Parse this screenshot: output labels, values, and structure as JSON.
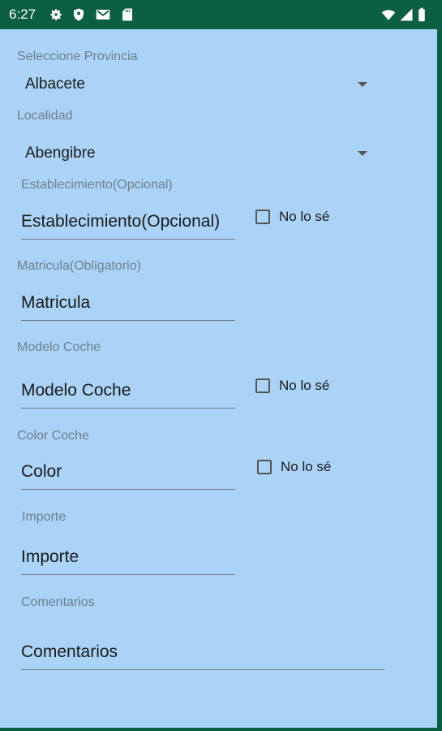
{
  "status_bar": {
    "time": "6:27",
    "left_icons": [
      "gear-icon",
      "shield-icon",
      "gmail-icon",
      "sd-card-icon"
    ],
    "right_icons": [
      "wifi-icon",
      "signal-icon",
      "battery-icon"
    ]
  },
  "colors": {
    "status_bar": "#0d5f44",
    "background": "#aad3f7"
  },
  "form": {
    "provincia": {
      "label": "Seleccione Provincia",
      "value": "Albacete"
    },
    "localidad": {
      "label": "Localidad",
      "value": "Abengibre"
    },
    "establecimiento": {
      "label": "Establecimiento(Opcional)",
      "placeholder": "Establecimiento(Opcional)",
      "checkbox_label": "No lo sé"
    },
    "matricula": {
      "label": "Matricula(Obligatorio)",
      "placeholder": "Matricula"
    },
    "modelo": {
      "label": "Modelo Coche",
      "placeholder": "Modelo Coche",
      "checkbox_label": "No lo sé"
    },
    "color": {
      "label": "Color Coche",
      "placeholder": "Color",
      "checkbox_label": "No lo sé"
    },
    "importe": {
      "label": "Importe",
      "placeholder": "Importe"
    },
    "comentarios": {
      "label": "Comentarios",
      "placeholder": "Comentarios"
    }
  }
}
